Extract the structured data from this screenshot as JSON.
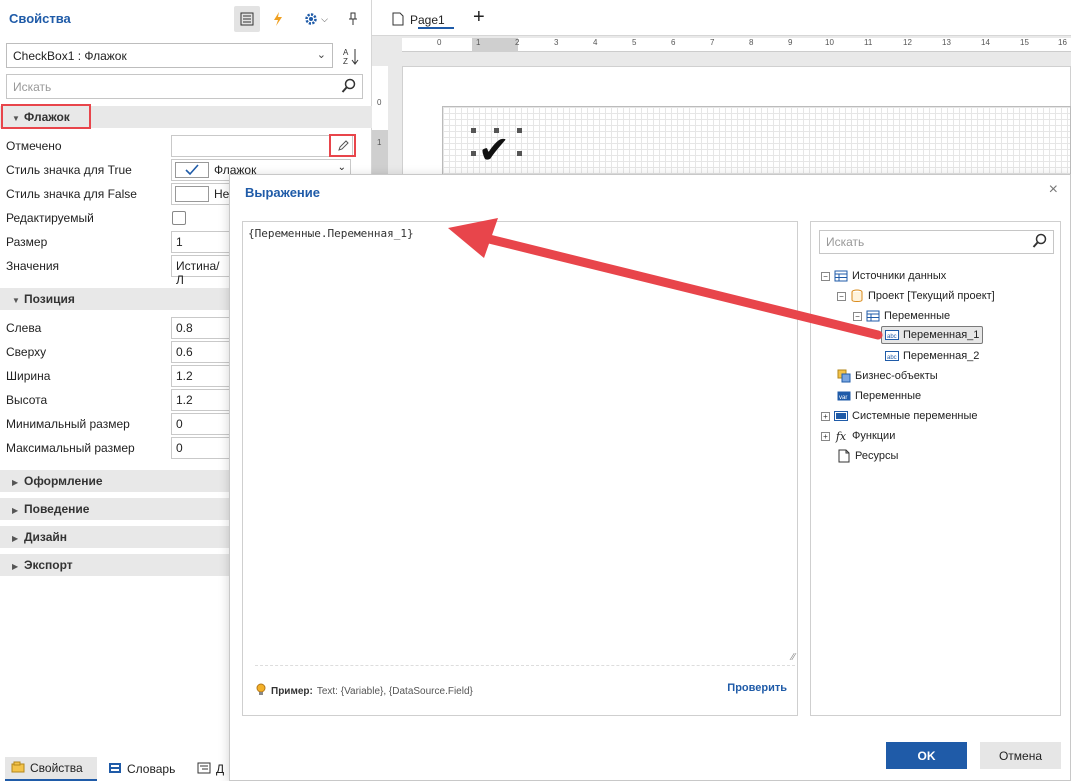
{
  "props": {
    "title": "Свойства",
    "object_select": "CheckBox1 : Флажок",
    "search_placeholder": "Искать",
    "groups": {
      "checkbox": "Флажок",
      "position": "Позиция",
      "design": "Оформление",
      "behavior": "Поведение",
      "designer": "Дизайн",
      "export": "Экспорт"
    },
    "rows": {
      "checked": "Отмечено",
      "true_style": "Стиль значка для True",
      "true_style_value": "Флажок",
      "false_style": "Стиль значка для False",
      "false_style_value": "Не",
      "editable": "Редактируемый",
      "size": "Размер",
      "size_value": "1",
      "values": "Значения",
      "values_value": "Истина/Л",
      "left": "Слева",
      "left_value": "0.8",
      "top": "Сверху",
      "top_value": "0.6",
      "width": "Ширина",
      "width_value": "1.2",
      "height": "Высота",
      "height_value": "1.2",
      "min_size": "Минимальный размер",
      "min_size_value": "0",
      "max_size": "Максимальный размер",
      "max_size_value": "0"
    },
    "tabs": {
      "properties": "Свойства",
      "dictionary": "Словарь",
      "third": "Д"
    }
  },
  "designer": {
    "page_tab": "Page1",
    "ruler_ticks": [
      "0",
      "1",
      "2",
      "3",
      "4",
      "5",
      "6",
      "7",
      "8",
      "9",
      "10",
      "11",
      "12",
      "13",
      "14",
      "15",
      "16"
    ],
    "vruler_ticks": [
      "0",
      "1"
    ]
  },
  "dialog": {
    "title": "Выражение",
    "expression": "{Переменные.Переменная_1}",
    "hint_label": "Пример:",
    "hint_text": "Text: {Variable},  {DataSource.Field}",
    "verify": "Проверить",
    "tree_search_placeholder": "Искать",
    "tree": {
      "data_sources": "Источники данных",
      "project": "Проект [Текущий проект]",
      "variables_folder": "Переменные",
      "var1": "Переменная_1",
      "var2": "Переменная_2",
      "business_objects": "Бизнес-объекты",
      "variables": "Переменные",
      "system_variables": "Системные переменные",
      "functions": "Функции",
      "resources": "Ресурсы"
    },
    "ok": "OK",
    "cancel": "Отмена"
  },
  "colors": {
    "accent": "#1f5ba8",
    "highlight": "#e8454b",
    "arrow": "#e8454b"
  }
}
